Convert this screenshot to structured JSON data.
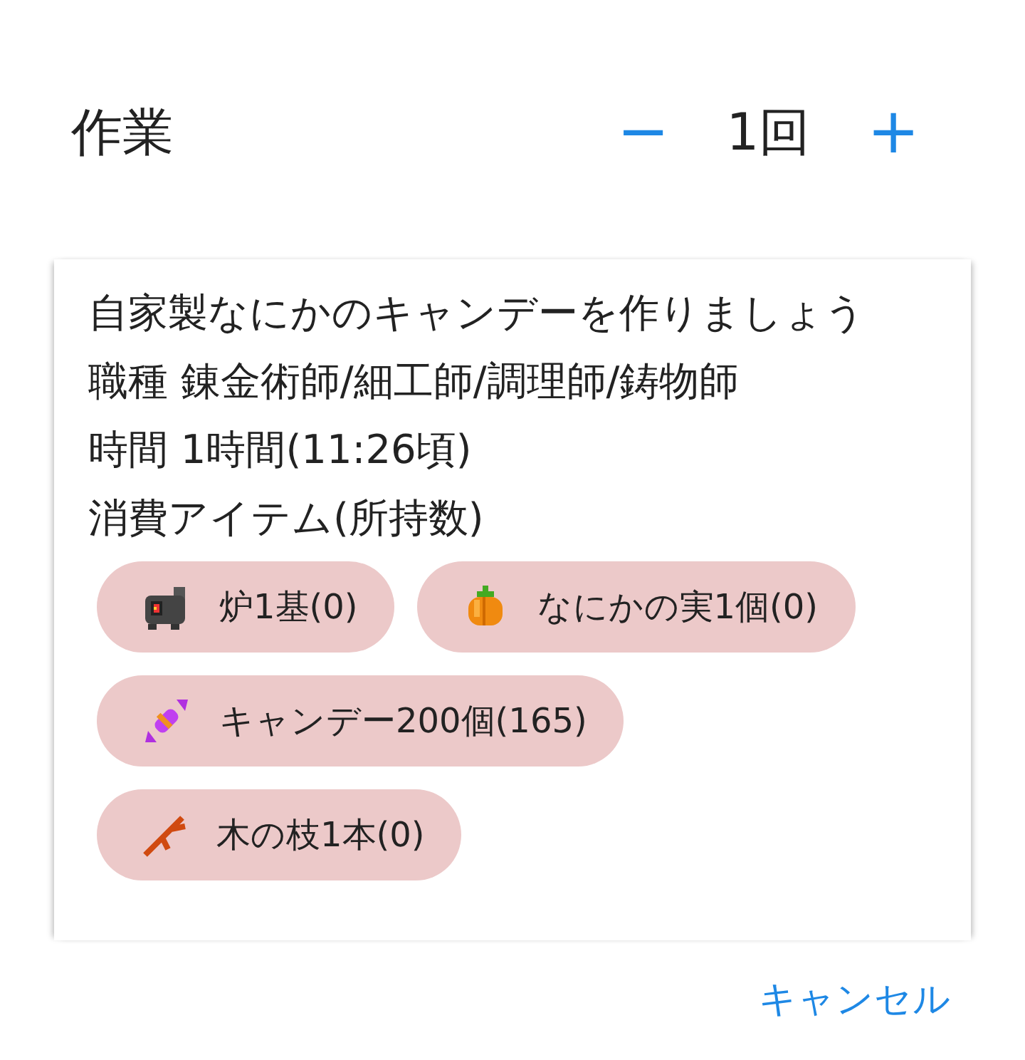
{
  "dialog": {
    "title": "作業",
    "count": {
      "minus": "−",
      "value": "1回",
      "plus": "+"
    }
  },
  "recipe": {
    "description": "自家製なにかのキャンデーを作りましょう",
    "jobs": "職種 錬金術師/細工師/調理師/鋳物師",
    "time": "時間 1時間(11:26頃)",
    "items_heading": "消費アイテム(所持数)",
    "items": [
      {
        "kind": "furnace",
        "label": "炉1基(0)"
      },
      {
        "kind": "fruit",
        "label": "なにかの実1個(0)"
      },
      {
        "kind": "candy",
        "label": "キャンデー200個(165)"
      },
      {
        "kind": "branch",
        "label": "木の枝1本(0)"
      }
    ]
  },
  "actions": [
    "キャンセル"
  ]
}
